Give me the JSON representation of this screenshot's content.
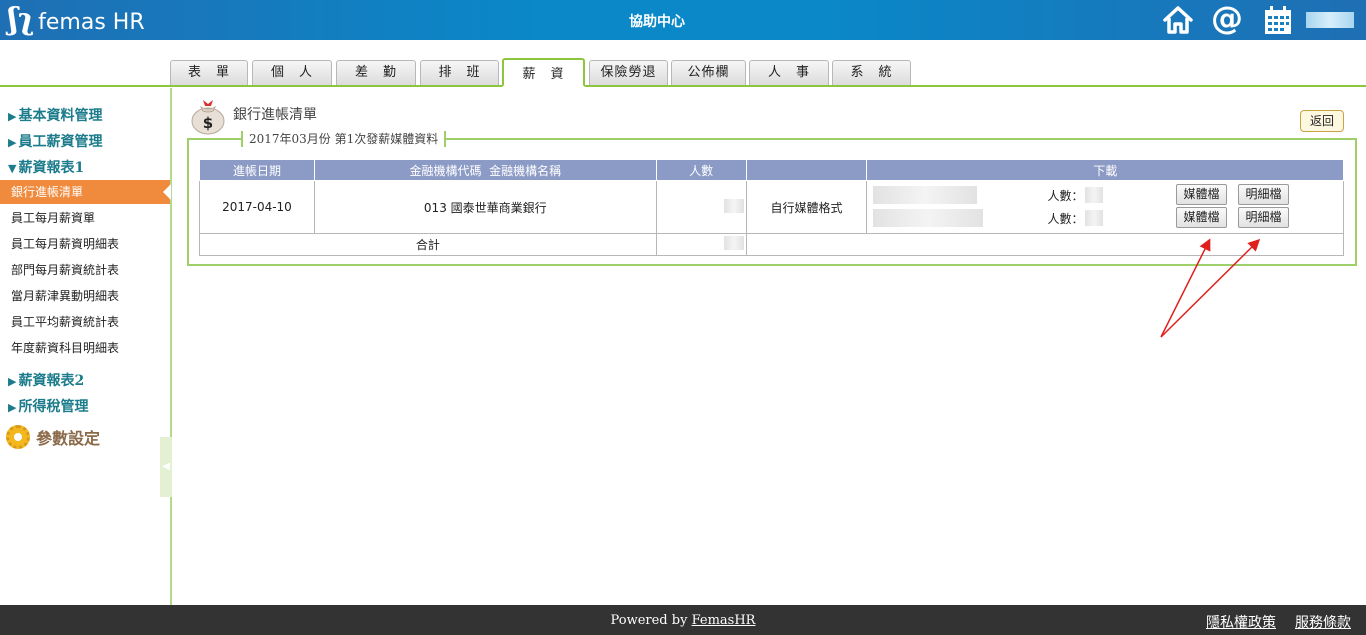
{
  "header": {
    "logo_text": "femas HR",
    "help_center": "協助中心"
  },
  "tabs": [
    "表　單",
    "個　人",
    "差　勤",
    "排　班",
    "薪　資",
    "保險勞退",
    "公佈欄",
    "人　事",
    "系　統"
  ],
  "active_tab": "薪　資",
  "sidebar": {
    "sections": [
      "基本資料管理",
      "員工薪資管理",
      "薪資報表1",
      "薪資報表2",
      "所得稅管理"
    ],
    "report1_items": [
      "銀行進帳清單",
      "員工每月薪資單",
      "員工每月薪資明細表",
      "部門每月薪資統計表",
      "當月薪津異動明細表",
      "員工平均薪資統計表",
      "年度薪資科目明細表"
    ],
    "param": "參數設定"
  },
  "main": {
    "title": "銀行進帳清單",
    "back": "返回",
    "legend": "2017年03月份 第1次發薪媒體資料",
    "table": {
      "headers": [
        "進帳日期",
        "金融機構代碼  金融機構名稱",
        "人數",
        "",
        "下載"
      ],
      "row": {
        "date": "2017-04-10",
        "bank": "013 國泰世華商業銀行",
        "format": "自行媒體格式",
        "count_label": "人數：",
        "media_btn": "媒體檔",
        "detail_btn": "明細檔"
      },
      "total_label": "合計"
    }
  },
  "footer": {
    "powered_prefix": "Powered by ",
    "powered_link": "FemasHR",
    "privacy": "隱私權政策",
    "terms": "服務條款"
  }
}
